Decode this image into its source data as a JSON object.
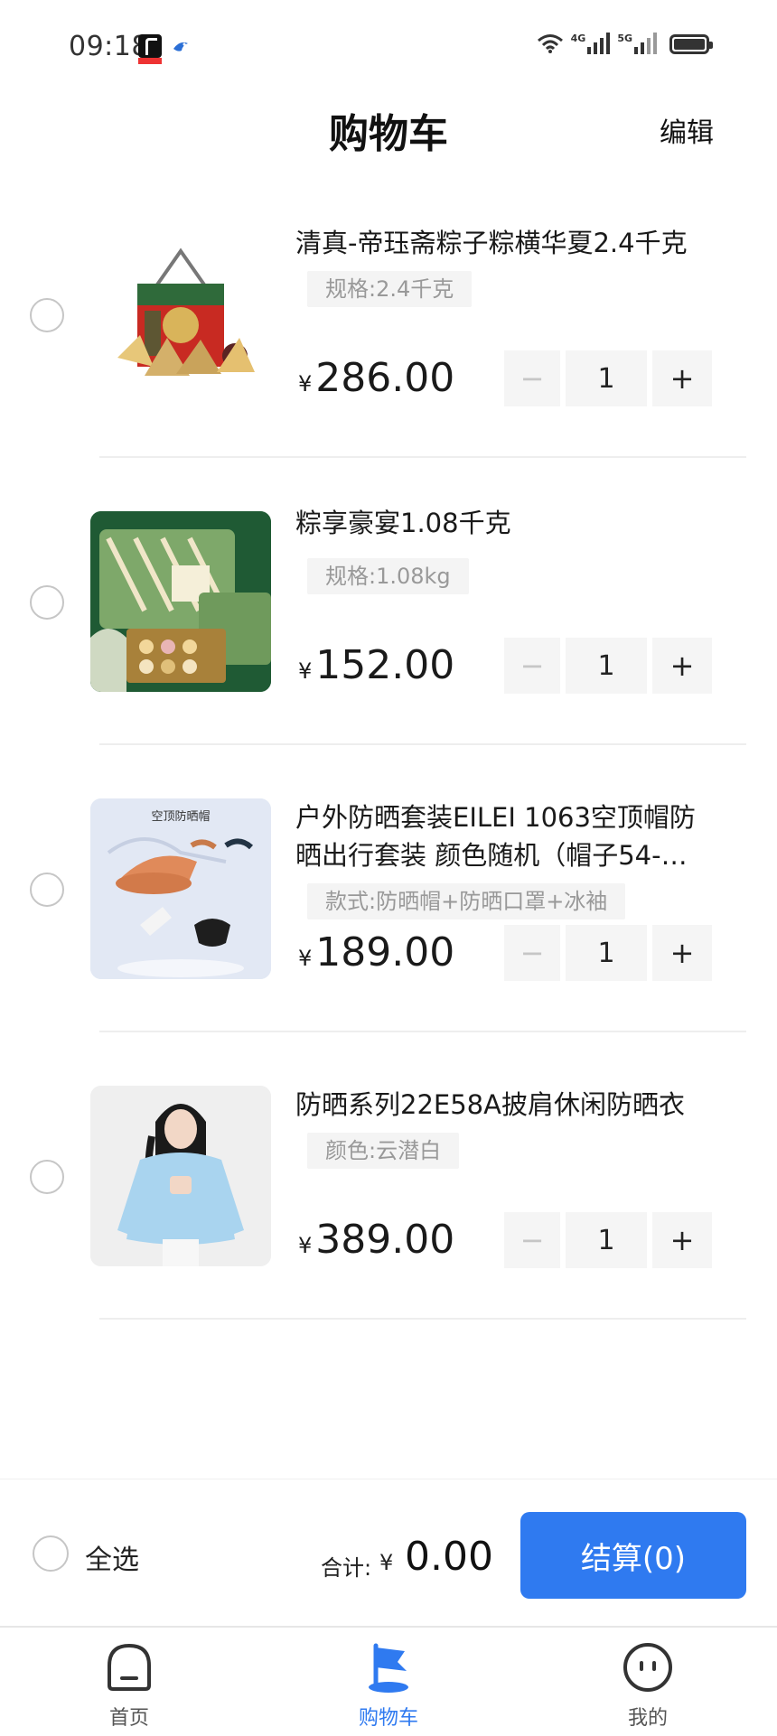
{
  "status": {
    "time": "09:18",
    "net1": "4G",
    "net2": "5G"
  },
  "header": {
    "title": "购物车",
    "edit": "编辑"
  },
  "cart": [
    {
      "title": "清真-帝珏斋粽子粽横华夏2.4千克",
      "spec": "规格:2.4千克",
      "currency": "¥",
      "price": "286.00",
      "quantity": "1"
    },
    {
      "title": "粽享豪宴1.08千克",
      "spec": "规格:1.08kg",
      "currency": "¥",
      "price": "152.00",
      "quantity": "1"
    },
    {
      "title": "户外防晒套装EILEI 1063空顶帽防晒出行套装 颜色随机（帽子54-…",
      "spec": "款式:防晒帽+防晒口罩+冰袖",
      "currency": "¥",
      "price": "189.00",
      "quantity": "1",
      "thumb_caption": "空顶防晒帽"
    },
    {
      "title": "防晒系列22E58A披肩休闲防晒衣",
      "spec": "颜色:云潜白",
      "currency": "¥",
      "price": "389.00",
      "quantity": "1"
    }
  ],
  "stepper": {
    "minus": "−",
    "plus": "+"
  },
  "footer": {
    "select_all": "全选",
    "total_label": "合计:",
    "currency": "¥",
    "total": "0.00",
    "checkout": "结算(0)"
  },
  "tabs": [
    {
      "label": "首页",
      "icon": "home-icon"
    },
    {
      "label": "购物车",
      "icon": "cart-flag-icon",
      "active": true
    },
    {
      "label": "我的",
      "icon": "profile-face-icon"
    }
  ],
  "colors": {
    "accent": "#2f7af0",
    "radio_border": "#c6c6c6",
    "spec_bg": "#f4f4f4"
  }
}
